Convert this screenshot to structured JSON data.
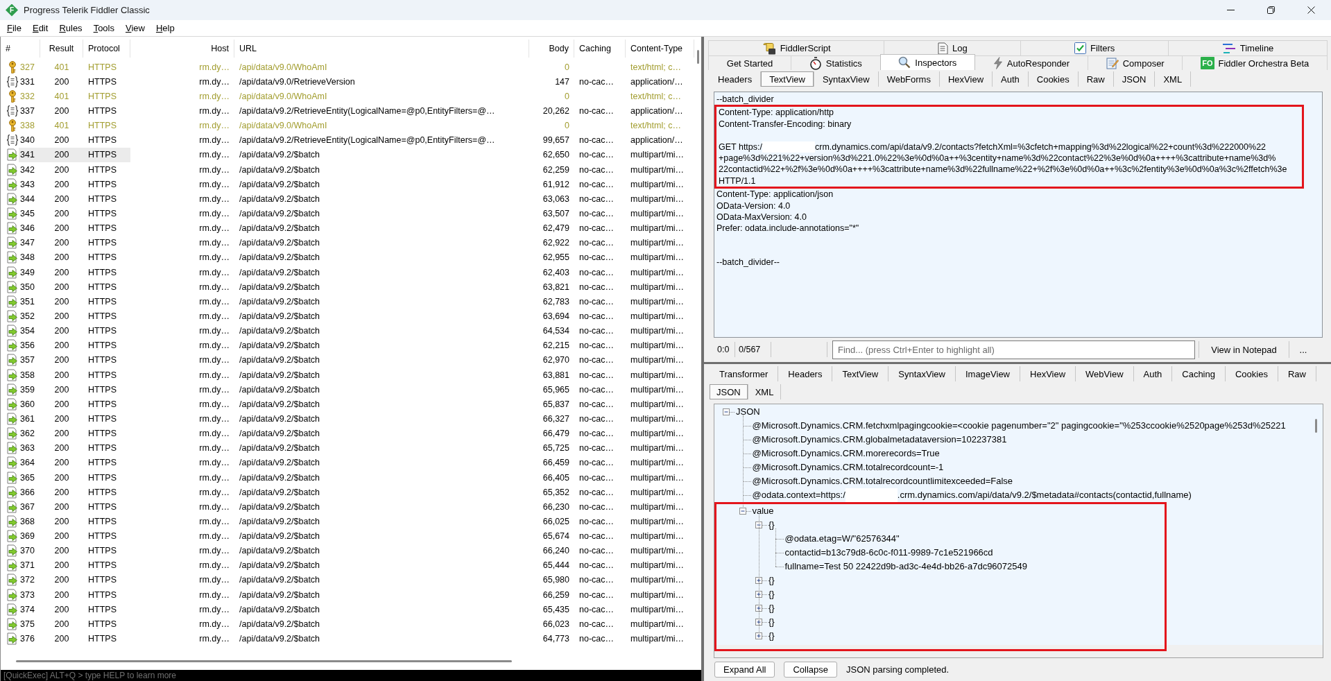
{
  "window": {
    "logo": "F",
    "title": "Progress Telerik Fiddler Classic"
  },
  "menu": [
    "File",
    "Edit",
    "Rules",
    "Tools",
    "View",
    "Help"
  ],
  "sessions": {
    "columns": [
      "#",
      "Result",
      "Protocol",
      "Host",
      "URL",
      "Body",
      "Caching",
      "Content-Type"
    ],
    "rows": [
      {
        "kind": "auth",
        "number": "327",
        "result": "401",
        "protocol": "HTTPS",
        "host": "rm.dy…",
        "url": "/api/data/v9.0/WhoAmI",
        "body": "0",
        "content_type": "text/html; c…",
        "selected": false
      },
      {
        "kind": "json",
        "number": "331",
        "result": "200",
        "protocol": "HTTPS",
        "host": "rm.dy…",
        "url": "/api/data/v9.0/RetrieveVersion",
        "body": "147",
        "caching": "no-cac…",
        "content_type": "application/…",
        "selected": false
      },
      {
        "kind": "auth",
        "number": "332",
        "result": "401",
        "protocol": "HTTPS",
        "host": "rm.dy…",
        "url": "/api/data/v9.0/WhoAmI",
        "body": "0",
        "content_type": "text/html; c…",
        "selected": false
      },
      {
        "kind": "json",
        "number": "337",
        "result": "200",
        "protocol": "HTTPS",
        "host": "rm.dy…",
        "url": "/api/data/v9.2/RetrieveEntity(LogicalName=@p0,EntityFilters=@…",
        "body": "20,262",
        "caching": "no-cac…",
        "content_type": "application/…",
        "selected": false
      },
      {
        "kind": "auth",
        "number": "338",
        "result": "401",
        "protocol": "HTTPS",
        "host": "rm.dy…",
        "url": "/api/data/v9.0/WhoAmI",
        "body": "0",
        "content_type": "text/html; c…",
        "selected": false
      },
      {
        "kind": "json",
        "number": "340",
        "result": "200",
        "protocol": "HTTPS",
        "host": "rm.dy…",
        "url": "/api/data/v9.2/RetrieveEntity(LogicalName=@p0,EntityFilters=@…",
        "body": "99,657",
        "caching": "no-cac…",
        "content_type": "application/…",
        "selected": false
      },
      {
        "kind": "batch",
        "number": "341",
        "result": "200",
        "protocol": "HTTPS",
        "host": "rm.dy…",
        "url": "/api/data/v9.2/$batch",
        "body": "62,650",
        "caching": "no-cac…",
        "content_type": "multipart/mi…",
        "selected": true
      },
      {
        "kind": "batch",
        "number": "342",
        "result": "200",
        "protocol": "HTTPS",
        "host": "rm.dy…",
        "url": "/api/data/v9.2/$batch",
        "body": "62,259",
        "caching": "no-cac…",
        "content_type": "multipart/mi…",
        "selected": false
      },
      {
        "kind": "batch",
        "number": "343",
        "result": "200",
        "protocol": "HTTPS",
        "host": "rm.dy…",
        "url": "/api/data/v9.2/$batch",
        "body": "61,912",
        "caching": "no-cac…",
        "content_type": "multipart/mi…",
        "selected": false
      },
      {
        "kind": "batch",
        "number": "344",
        "result": "200",
        "protocol": "HTTPS",
        "host": "rm.dy…",
        "url": "/api/data/v9.2/$batch",
        "body": "63,063",
        "caching": "no-cac…",
        "content_type": "multipart/mi…",
        "selected": false
      },
      {
        "kind": "batch",
        "number": "345",
        "result": "200",
        "protocol": "HTTPS",
        "host": "rm.dy…",
        "url": "/api/data/v9.2/$batch",
        "body": "63,507",
        "caching": "no-cac…",
        "content_type": "multipart/mi…",
        "selected": false
      },
      {
        "kind": "batch",
        "number": "346",
        "result": "200",
        "protocol": "HTTPS",
        "host": "rm.dy…",
        "url": "/api/data/v9.2/$batch",
        "body": "62,479",
        "caching": "no-cac…",
        "content_type": "multipart/mi…",
        "selected": false
      },
      {
        "kind": "batch",
        "number": "347",
        "result": "200",
        "protocol": "HTTPS",
        "host": "rm.dy…",
        "url": "/api/data/v9.2/$batch",
        "body": "62,922",
        "caching": "no-cac…",
        "content_type": "multipart/mi…",
        "selected": false
      },
      {
        "kind": "batch",
        "number": "348",
        "result": "200",
        "protocol": "HTTPS",
        "host": "rm.dy…",
        "url": "/api/data/v9.2/$batch",
        "body": "62,955",
        "caching": "no-cac…",
        "content_type": "multipart/mi…",
        "selected": false
      },
      {
        "kind": "batch",
        "number": "349",
        "result": "200",
        "protocol": "HTTPS",
        "host": "rm.dy…",
        "url": "/api/data/v9.2/$batch",
        "body": "62,403",
        "caching": "no-cac…",
        "content_type": "multipart/mi…",
        "selected": false
      },
      {
        "kind": "batch",
        "number": "350",
        "result": "200",
        "protocol": "HTTPS",
        "host": "rm.dy…",
        "url": "/api/data/v9.2/$batch",
        "body": "63,821",
        "caching": "no-cac…",
        "content_type": "multipart/mi…",
        "selected": false
      },
      {
        "kind": "batch",
        "number": "351",
        "result": "200",
        "protocol": "HTTPS",
        "host": "rm.dy…",
        "url": "/api/data/v9.2/$batch",
        "body": "62,783",
        "caching": "no-cac…",
        "content_type": "multipart/mi…",
        "selected": false
      },
      {
        "kind": "batch",
        "number": "352",
        "result": "200",
        "protocol": "HTTPS",
        "host": "rm.dy…",
        "url": "/api/data/v9.2/$batch",
        "body": "63,694",
        "caching": "no-cac…",
        "content_type": "multipart/mi…",
        "selected": false
      },
      {
        "kind": "batch",
        "number": "354",
        "result": "200",
        "protocol": "HTTPS",
        "host": "rm.dy…",
        "url": "/api/data/v9.2/$batch",
        "body": "64,534",
        "caching": "no-cac…",
        "content_type": "multipart/mi…",
        "selected": false
      },
      {
        "kind": "batch",
        "number": "356",
        "result": "200",
        "protocol": "HTTPS",
        "host": "rm.dy…",
        "url": "/api/data/v9.2/$batch",
        "body": "62,215",
        "caching": "no-cac…",
        "content_type": "multipart/mi…",
        "selected": false
      },
      {
        "kind": "batch",
        "number": "357",
        "result": "200",
        "protocol": "HTTPS",
        "host": "rm.dy…",
        "url": "/api/data/v9.2/$batch",
        "body": "62,970",
        "caching": "no-cac…",
        "content_type": "multipart/mi…",
        "selected": false
      },
      {
        "kind": "batch",
        "number": "358",
        "result": "200",
        "protocol": "HTTPS",
        "host": "rm.dy…",
        "url": "/api/data/v9.2/$batch",
        "body": "63,881",
        "caching": "no-cac…",
        "content_type": "multipart/mi…",
        "selected": false
      },
      {
        "kind": "batch",
        "number": "359",
        "result": "200",
        "protocol": "HTTPS",
        "host": "rm.dy…",
        "url": "/api/data/v9.2/$batch",
        "body": "65,965",
        "caching": "no-cac…",
        "content_type": "multipart/mi…",
        "selected": false
      },
      {
        "kind": "batch",
        "number": "360",
        "result": "200",
        "protocol": "HTTPS",
        "host": "rm.dy…",
        "url": "/api/data/v9.2/$batch",
        "body": "65,837",
        "caching": "no-cac…",
        "content_type": "multipart/mi…",
        "selected": false
      },
      {
        "kind": "batch",
        "number": "361",
        "result": "200",
        "protocol": "HTTPS",
        "host": "rm.dy…",
        "url": "/api/data/v9.2/$batch",
        "body": "66,327",
        "caching": "no-cac…",
        "content_type": "multipart/mi…",
        "selected": false
      },
      {
        "kind": "batch",
        "number": "362",
        "result": "200",
        "protocol": "HTTPS",
        "host": "rm.dy…",
        "url": "/api/data/v9.2/$batch",
        "body": "66,479",
        "caching": "no-cac…",
        "content_type": "multipart/mi…",
        "selected": false
      },
      {
        "kind": "batch",
        "number": "363",
        "result": "200",
        "protocol": "HTTPS",
        "host": "rm.dy…",
        "url": "/api/data/v9.2/$batch",
        "body": "65,725",
        "caching": "no-cac…",
        "content_type": "multipart/mi…",
        "selected": false
      },
      {
        "kind": "batch",
        "number": "364",
        "result": "200",
        "protocol": "HTTPS",
        "host": "rm.dy…",
        "url": "/api/data/v9.2/$batch",
        "body": "66,459",
        "caching": "no-cac…",
        "content_type": "multipart/mi…",
        "selected": false
      },
      {
        "kind": "batch",
        "number": "365",
        "result": "200",
        "protocol": "HTTPS",
        "host": "rm.dy…",
        "url": "/api/data/v9.2/$batch",
        "body": "66,405",
        "caching": "no-cac…",
        "content_type": "multipart/mi…",
        "selected": false
      },
      {
        "kind": "batch",
        "number": "366",
        "result": "200",
        "protocol": "HTTPS",
        "host": "rm.dy…",
        "url": "/api/data/v9.2/$batch",
        "body": "65,352",
        "caching": "no-cac…",
        "content_type": "multipart/mi…",
        "selected": false
      },
      {
        "kind": "batch",
        "number": "367",
        "result": "200",
        "protocol": "HTTPS",
        "host": "rm.dy…",
        "url": "/api/data/v9.2/$batch",
        "body": "66,230",
        "caching": "no-cac…",
        "content_type": "multipart/mi…",
        "selected": false
      },
      {
        "kind": "batch",
        "number": "368",
        "result": "200",
        "protocol": "HTTPS",
        "host": "rm.dy…",
        "url": "/api/data/v9.2/$batch",
        "body": "66,025",
        "caching": "no-cac…",
        "content_type": "multipart/mi…",
        "selected": false
      },
      {
        "kind": "batch",
        "number": "369",
        "result": "200",
        "protocol": "HTTPS",
        "host": "rm.dy…",
        "url": "/api/data/v9.2/$batch",
        "body": "65,674",
        "caching": "no-cac…",
        "content_type": "multipart/mi…",
        "selected": false
      },
      {
        "kind": "batch",
        "number": "370",
        "result": "200",
        "protocol": "HTTPS",
        "host": "rm.dy…",
        "url": "/api/data/v9.2/$batch",
        "body": "66,240",
        "caching": "no-cac…",
        "content_type": "multipart/mi…",
        "selected": false
      },
      {
        "kind": "batch",
        "number": "371",
        "result": "200",
        "protocol": "HTTPS",
        "host": "rm.dy…",
        "url": "/api/data/v9.2/$batch",
        "body": "65,444",
        "caching": "no-cac…",
        "content_type": "multipart/mi…",
        "selected": false
      },
      {
        "kind": "batch",
        "number": "372",
        "result": "200",
        "protocol": "HTTPS",
        "host": "rm.dy…",
        "url": "/api/data/v9.2/$batch",
        "body": "65,980",
        "caching": "no-cac…",
        "content_type": "multipart/mi…",
        "selected": false
      },
      {
        "kind": "batch",
        "number": "373",
        "result": "200",
        "protocol": "HTTPS",
        "host": "rm.dy…",
        "url": "/api/data/v9.2/$batch",
        "body": "66,259",
        "caching": "no-cac…",
        "content_type": "multipart/mi…",
        "selected": false
      },
      {
        "kind": "batch",
        "number": "374",
        "result": "200",
        "protocol": "HTTPS",
        "host": "rm.dy…",
        "url": "/api/data/v9.2/$batch",
        "body": "65,435",
        "caching": "no-cac…",
        "content_type": "multipart/mi…",
        "selected": false
      },
      {
        "kind": "batch",
        "number": "375",
        "result": "200",
        "protocol": "HTTPS",
        "host": "rm.dy…",
        "url": "/api/data/v9.2/$batch",
        "body": "66,023",
        "caching": "no-cac…",
        "content_type": "multipart/mi…",
        "selected": false
      },
      {
        "kind": "batch",
        "number": "376",
        "result": "200",
        "protocol": "HTTPS",
        "host": "rm.dy…",
        "url": "/api/data/v9.2/$batch",
        "body": "64,773",
        "caching": "no-cac…",
        "content_type": "multipart/mi…",
        "selected": false
      }
    ]
  },
  "quickexec": {
    "placeholder": "[QuickExec] ALT+Q > type HELP to learn more"
  },
  "tool_tabs": [
    {
      "tabs": [
        {
          "kind": "script",
          "label": "FiddlerScript",
          "selected": false
        },
        {
          "kind": "log",
          "label": "Log",
          "selected": false
        },
        {
          "kind": "filters",
          "label": "Filters",
          "selected": false
        },
        {
          "kind": "timeline",
          "label": "Timeline",
          "selected": false
        }
      ]
    },
    {
      "tabs": [
        {
          "kind": "plain",
          "label": "Get Started",
          "selected": false
        },
        {
          "kind": "stopwatch",
          "label": "Statistics",
          "selected": false
        },
        {
          "kind": "magnifier",
          "label": "Inspectors",
          "selected": true
        },
        {
          "kind": "bolt",
          "label": "AutoResponder",
          "selected": false
        },
        {
          "kind": "notepad",
          "label": "Composer",
          "selected": false
        },
        {
          "kind": "badge",
          "badge": "FO",
          "label": "Fiddler Orchestra Beta",
          "selected": false
        }
      ]
    }
  ],
  "request": {
    "tabs": [
      {
        "label": "Headers",
        "selected": false
      },
      {
        "label": "TextView",
        "selected": true
      },
      {
        "label": "SyntaxView",
        "selected": false
      },
      {
        "label": "WebForms",
        "selected": false
      },
      {
        "label": "HexView",
        "selected": false
      },
      {
        "label": "Auth",
        "selected": false
      },
      {
        "label": "Cookies",
        "selected": false
      },
      {
        "label": "Raw",
        "selected": false
      },
      {
        "label": "JSON",
        "selected": false
      },
      {
        "label": "XML",
        "selected": false
      }
    ],
    "text_blocks": [
      {
        "highlighted": false,
        "lines": [
          {
            "kind": "text",
            "text": "--batch_divider"
          }
        ]
      },
      {
        "highlighted": true,
        "lines": [
          {
            "kind": "text",
            "text": "Content-Type: application/http"
          },
          {
            "kind": "text",
            "text": "Content-Transfer-Encoding: binary"
          },
          {
            "kind": "blank"
          },
          {
            "kind": "redacted",
            "before": "GET https:/",
            "after": "crm.dynamics.com/api/data/v9.2/contacts?fetchXml=%3cfetch+mapping%3d%22logical%22+count%3d%222000%22"
          },
          {
            "kind": "text",
            "text": "+page%3d%221%22+version%3d%221.0%22%3e%0d%0a++%3centity+name%3d%22contact%22%3e%0d%0a++++%3cattribute+name%3d%"
          },
          {
            "kind": "text",
            "text": "22contactid%22+%2f%3e%0d%0a++++%3cattribute+name%3d%22fullname%22+%2f%3e%0d%0a++%3c%2fentity%3e%0d%0a%3c%2ffetch%3e"
          },
          {
            "kind": "text",
            "text": "HTTP/1.1"
          }
        ]
      },
      {
        "highlighted": false,
        "lines": [
          {
            "kind": "text",
            "text": "Content-Type: application/json"
          },
          {
            "kind": "text",
            "text": "OData-Version: 4.0"
          },
          {
            "kind": "text",
            "text": "OData-MaxVersion: 4.0"
          },
          {
            "kind": "text",
            "text": "Prefer: odata.include-annotations=\"*\""
          },
          {
            "kind": "blank"
          },
          {
            "kind": "blank"
          },
          {
            "kind": "text",
            "text": "--batch_divider--"
          }
        ]
      }
    ],
    "status": {
      "position": "0:0",
      "selection": "0/567"
    },
    "find": {
      "placeholder": "Find... (press Ctrl+Enter to highlight all)"
    },
    "buttons": [
      "View in Notepad",
      "..."
    ]
  },
  "response": {
    "tab_rows": [
      {
        "tabs": [
          {
            "label": "Transformer",
            "selected": false
          },
          {
            "label": "Headers",
            "selected": false
          },
          {
            "label": "TextView",
            "selected": false
          },
          {
            "label": "SyntaxView",
            "selected": false
          },
          {
            "label": "ImageView",
            "selected": false
          },
          {
            "label": "HexView",
            "selected": false
          },
          {
            "label": "WebView",
            "selected": false
          },
          {
            "label": "Auth",
            "selected": false
          },
          {
            "label": "Caching",
            "selected": false
          },
          {
            "label": "Cookies",
            "selected": false
          },
          {
            "label": "Raw",
            "selected": false
          }
        ]
      },
      {
        "tabs": [
          {
            "label": "JSON",
            "selected": true
          },
          {
            "label": "XML",
            "selected": false
          }
        ]
      }
    ],
    "tree": {
      "kind": "branch",
      "label": "JSON",
      "expanded": true,
      "children": [
        {
          "kind": "leaf",
          "label": "@Microsoft.Dynamics.CRM.fetchxmlpagingcookie=<cookie pagenumber=\"2\" pagingcookie=\"%253ccookie%2520page%253d%25221",
          "highlighted": false
        },
        {
          "kind": "leaf",
          "label": "@Microsoft.Dynamics.CRM.globalmetadataversion=102237381",
          "highlighted": false
        },
        {
          "kind": "leaf",
          "label": "@Microsoft.Dynamics.CRM.morerecords=True",
          "highlighted": false
        },
        {
          "kind": "leaf",
          "label": "@Microsoft.Dynamics.CRM.totalrecordcount=-1",
          "highlighted": false
        },
        {
          "kind": "leaf",
          "label": "@Microsoft.Dynamics.CRM.totalrecordcountlimitexceeded=False",
          "highlighted": false
        },
        {
          "kind": "redacted",
          "before": "@odata.context=https:/",
          "after": ".crm.dynamics.com/api/data/v9.2/$metadata#contacts(contactid,fullname)",
          "highlighted": false
        },
        {
          "kind": "branch",
          "label": "value",
          "expanded": true,
          "highlighted": true,
          "children": [
            {
              "kind": "branch",
              "label": "{}",
              "expanded": true,
              "children": [
                {
                  "kind": "leaf",
                  "label": "@odata.etag=W/\"62576344\""
                },
                {
                  "kind": "leaf",
                  "label": "contactid=b13c79d8-6c0c-f011-9989-7c1e521966cd"
                },
                {
                  "kind": "leaf",
                  "label": "fullname=Test 50 22422d9b-ad3c-4e4d-bb26-a7dc96072549"
                }
              ]
            },
            {
              "kind": "branch",
              "label": "{}",
              "expanded": false
            },
            {
              "kind": "branch",
              "label": "{}",
              "expanded": false
            },
            {
              "kind": "branch",
              "label": "{}",
              "expanded": false
            },
            {
              "kind": "branch",
              "label": "{}",
              "expanded": false
            },
            {
              "kind": "branch",
              "label": "{}",
              "expanded": false
            }
          ]
        }
      ]
    },
    "buttons": [
      "Expand All",
      "Collapse"
    ],
    "status": "JSON parsing completed."
  }
}
